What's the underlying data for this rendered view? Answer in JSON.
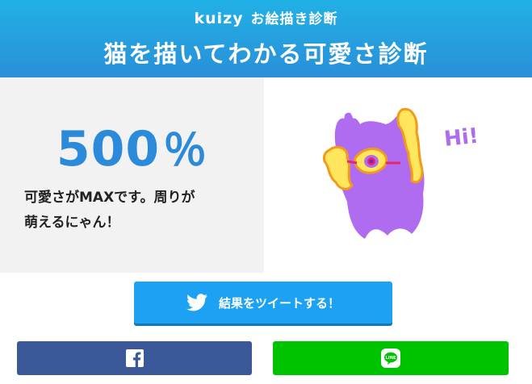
{
  "header": {
    "brand": "kuizy",
    "category": "お絵描き診断",
    "title": "猫を描いてわかる可愛さ診断"
  },
  "result": {
    "score": "500",
    "percent_sign": "％",
    "description_line1": "可愛さがMAXです。周りが",
    "description_line2": "萌えるにゃん！"
  },
  "drawing": {
    "caption": "Hi!"
  },
  "actions": {
    "tweet_label": "結果をツイートする！",
    "facebook_icon": "facebook-icon",
    "line_icon": "line-icon"
  },
  "colors": {
    "header_top": "#21b1e6",
    "header_bottom": "#2a8fd8",
    "score": "#2b8ad9",
    "twitter": "#1da1f2",
    "facebook": "#3b5998",
    "line": "#00c300",
    "cat": "#b06cf0"
  }
}
